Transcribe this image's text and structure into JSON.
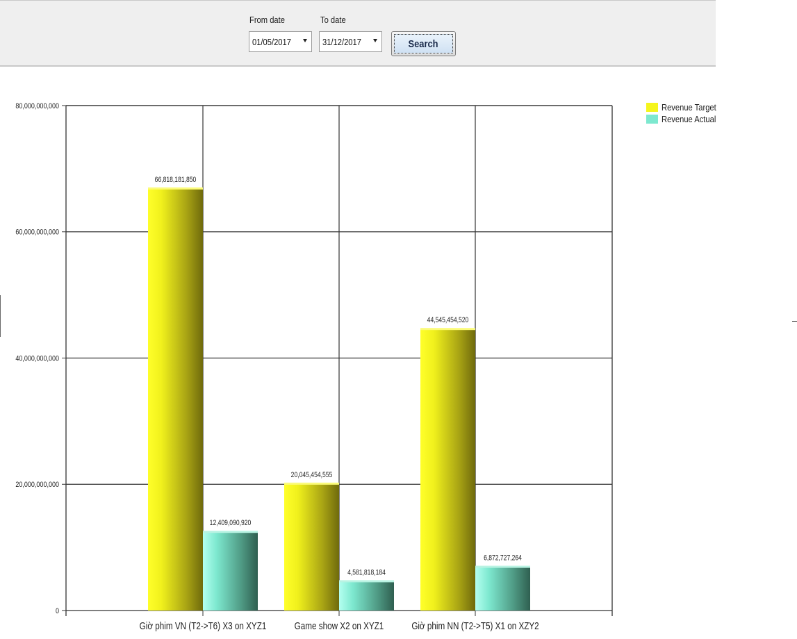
{
  "filters": {
    "from_label": "From date",
    "from_value": "01/05/2017",
    "to_label": "To date",
    "to_value": "31/12/2017",
    "search_label": "Search"
  },
  "colors": {
    "target": "#f2f21a",
    "actual": "#7de8cf",
    "toolbar": "#efefef"
  },
  "chart_data": {
    "type": "bar",
    "categories": [
      "Giờ phim VN (T2->T6) X3 on XYZ1",
      "Game show X2 on XYZ1",
      "Giờ phim NN (T2->T5) X1 on XZY2"
    ],
    "series": [
      {
        "name": "Revenue Target",
        "values": [
          66818181850,
          20045454555,
          44545454520
        ],
        "labels": [
          "66,818,181,850",
          "20,045,454,555",
          "44,545,454,520"
        ]
      },
      {
        "name": "Revenue Actual",
        "values": [
          12409090920,
          4581818184,
          6872727264
        ],
        "labels": [
          "12,409,090,920",
          "4,581,818,184",
          "6,872,727,264"
        ]
      }
    ],
    "yticks": [
      0,
      20000000000,
      40000000000,
      60000000000,
      80000000000
    ],
    "ytick_labels": [
      "0",
      "20,000,000,000",
      "40,000,000,000",
      "60,000,000,000",
      "80,000,000,000"
    ],
    "ylim": [
      0,
      80000000000
    ],
    "grid": true,
    "legend_position": "top-right"
  }
}
